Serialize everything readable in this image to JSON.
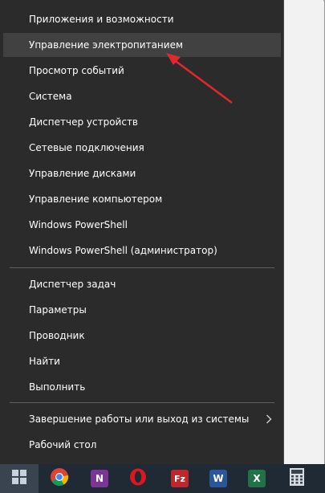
{
  "menu": {
    "items": [
      {
        "label": "Приложения и возможности"
      },
      {
        "label": "Управление электропитанием"
      },
      {
        "label": "Просмотр событий"
      },
      {
        "label": "Система"
      },
      {
        "label": "Диспетчер устройств"
      },
      {
        "label": "Сетевые подключения"
      },
      {
        "label": "Управление дисками"
      },
      {
        "label": "Управление компьютером"
      },
      {
        "label": "Windows PowerShell"
      },
      {
        "label": "Windows PowerShell (администратор)"
      },
      {
        "label": "Диспетчер задач"
      },
      {
        "label": "Параметры"
      },
      {
        "label": "Проводник"
      },
      {
        "label": "Найти"
      },
      {
        "label": "Выполнить"
      },
      {
        "label": "Завершение работы или выход из системы"
      },
      {
        "label": "Рабочий стол"
      }
    ],
    "highlighted_index": 1
  },
  "taskbar": {
    "icons": [
      {
        "name": "windows-start-icon"
      },
      {
        "name": "chrome-icon"
      },
      {
        "name": "onenote-icon",
        "glyph": "N"
      },
      {
        "name": "opera-icon",
        "glyph": "O"
      },
      {
        "name": "filezilla-icon",
        "glyph": "Fz"
      },
      {
        "name": "word-icon",
        "glyph": "W"
      },
      {
        "name": "excel-icon",
        "glyph": "X"
      },
      {
        "name": "calculator-icon"
      }
    ]
  },
  "colors": {
    "menu_bg": "#2b2b2b",
    "menu_hover": "#414141",
    "menu_text": "#ffffff",
    "taskbar_bg": "#1f2a35",
    "annotation_arrow": "#e0282e"
  }
}
